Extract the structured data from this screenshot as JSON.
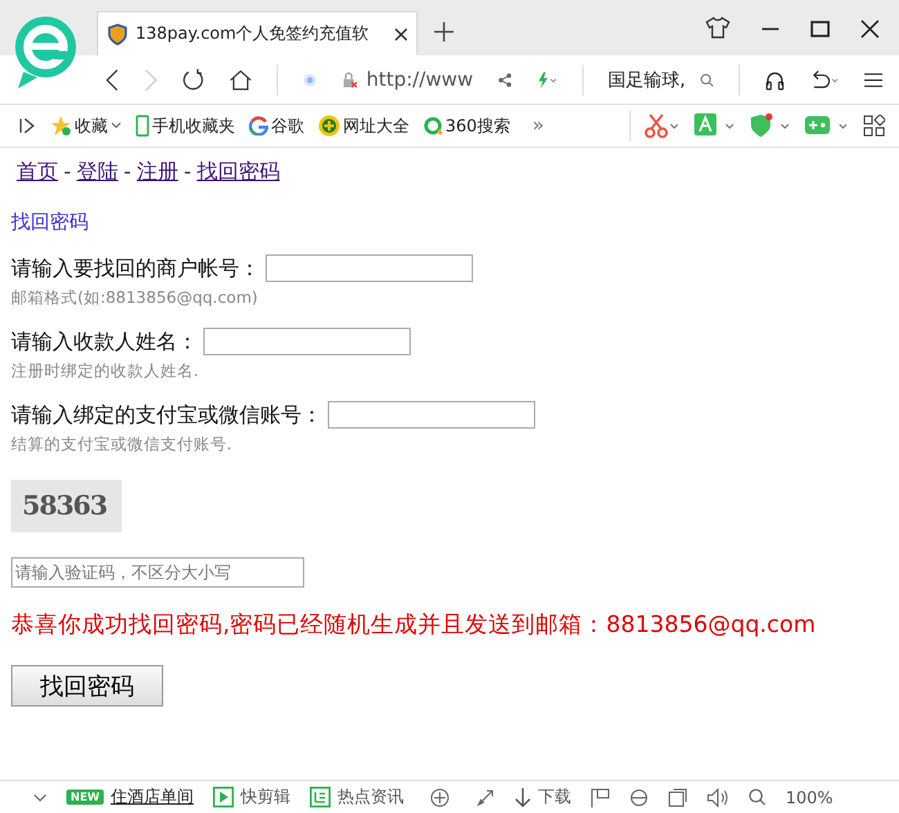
{
  "browser": {
    "tab": {
      "title": "138pay.com个人免签约充值软",
      "selected": true
    },
    "address": "http://www",
    "search": "国足输球,",
    "bookmarks": [
      {
        "label": "收藏",
        "kind": "star"
      },
      {
        "label": "手机收藏夹",
        "kind": "phone"
      },
      {
        "label": "谷歌",
        "kind": "google"
      },
      {
        "label": "网址大全",
        "kind": "plus"
      },
      {
        "label": "360搜索",
        "kind": "ring"
      }
    ],
    "more": "»"
  },
  "page": {
    "nav": [
      {
        "label": "首页"
      },
      {
        "label": "登陆"
      },
      {
        "label": "注册"
      },
      {
        "label": "找回密码"
      }
    ],
    "nav_separator": "-",
    "heading": "找回密码",
    "fields": [
      {
        "label": "请输入要找回的商户帐号：",
        "hint": "邮箱格式(如:8813856@qq.com)"
      },
      {
        "label": "请输入收款人姓名：",
        "hint": "注册时绑定的收款人姓名."
      },
      {
        "label": "请输入绑定的支付宝或微信账号：",
        "hint": "结算的支付宝或微信支付账号."
      }
    ],
    "captcha": "58363",
    "captcha_input": {
      "placeholder": "请输入验证码，不区分大小写"
    },
    "message": "恭喜你成功找回密码,密码已经随机生成并且发送到邮箱：8813856@qq.com",
    "button": "找回密码"
  },
  "status_bar": {
    "items": [
      {
        "kind": "new",
        "badge": "NEW",
        "label": "住酒店单间"
      },
      {
        "kind": "play",
        "label": "快剪辑"
      },
      {
        "kind": "news",
        "label": "热点资讯"
      },
      {
        "kind": "download",
        "label": "下载"
      }
    ],
    "zoom": "100%"
  }
}
